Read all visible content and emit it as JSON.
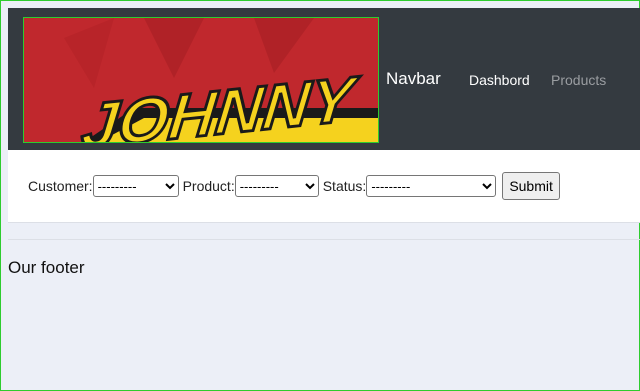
{
  "navbar": {
    "logo_alt": "JOHNNY",
    "brand": "Navbar",
    "links": [
      {
        "label": "Dashbord"
      },
      {
        "label": "Products"
      }
    ]
  },
  "filters": {
    "customer_label": "Customer:",
    "customer_value": "---------",
    "product_label": "Product:",
    "product_value": "---------",
    "status_label": "Status:",
    "status_value": "---------",
    "submit_label": "Submit"
  },
  "footer": {
    "text": "Our footer"
  },
  "colors": {
    "navbar_bg": "#343a40",
    "logo_red": "#c0282d",
    "logo_yellow": "#f5d21e",
    "page_bg": "#eceff7",
    "outline_green": "#2ecc2e"
  }
}
